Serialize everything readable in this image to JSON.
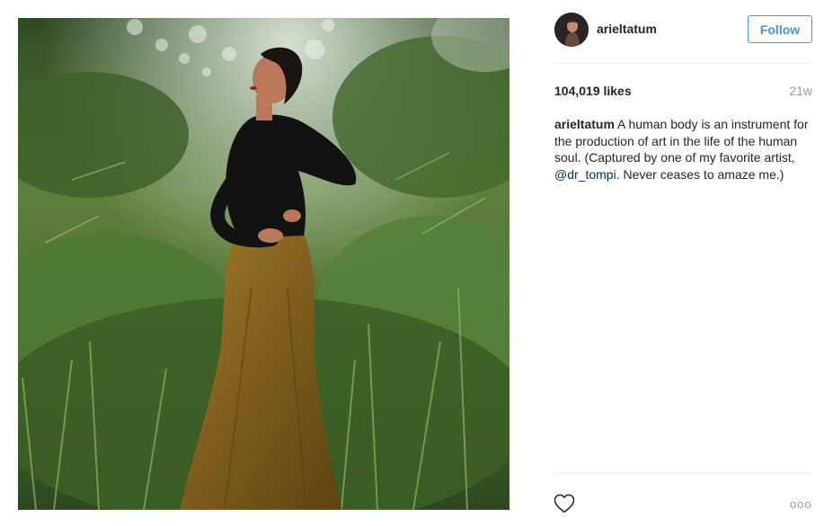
{
  "post": {
    "image_alt": "Woman in black lace top and gold mermaid skirt standing in front of green bamboo foliage"
  },
  "header": {
    "username": "arieltatum",
    "follow_label": "Follow",
    "accent_color": "#3897f0"
  },
  "meta": {
    "likes": "104,019 likes",
    "time_ago": "21w"
  },
  "caption": {
    "username": "arieltatum",
    "text_part1": " A human body is an instrument for the production of art in the life of the human soul. (Captured by one of my favorite artist, ",
    "mention": "@dr_tompi",
    "text_part2": ". Never ceases to amaze me.)",
    "mention_color": "#003569"
  },
  "actions": {
    "like_icon": "heart-icon",
    "more_label": "ooo",
    "more_icon": "more-options-icon"
  }
}
